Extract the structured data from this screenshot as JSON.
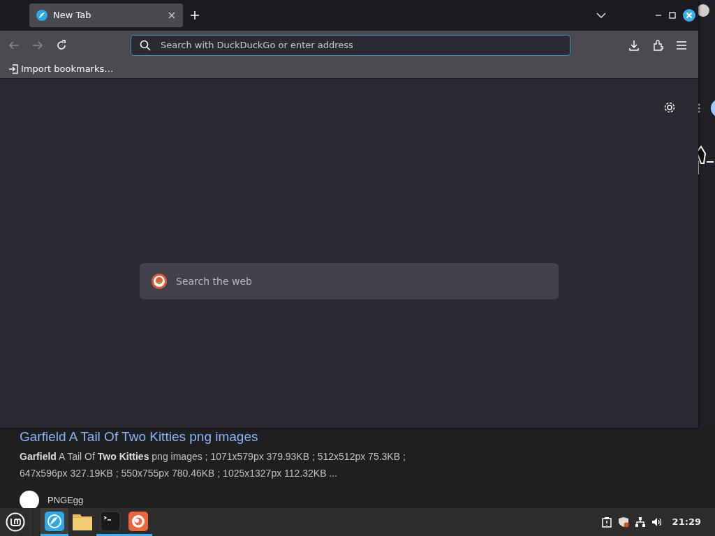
{
  "browser": {
    "tabs": [
      {
        "title": "New Tab",
        "selected": true
      }
    ],
    "address_bar": {
      "placeholder": "Search with DuckDuckGo or enter address"
    },
    "bookmarks": [
      {
        "label": "Import bookmarks…"
      }
    ],
    "new_tab_page": {
      "search": {
        "placeholder": "Search the web"
      }
    }
  },
  "background_page": {
    "result": {
      "title": "Garfield A Tail Of Two Kitties png images",
      "snippet": "**Garfield** A Tail Of **Two Kitties** png images ; 1071x579px 379.93KB ; 512x512px 75.3KB ; 647x596px 327.19KB ; 550x755px 780.46KB ; 1025x1327px 112.32KB ..."
    },
    "next_result": {
      "site": "PNGEgg"
    }
  },
  "taskbar": {
    "apps": [
      {
        "kind": "browser",
        "selected": true,
        "running": true
      },
      {
        "kind": "files",
        "selected": false,
        "running": false
      },
      {
        "kind": "terminal",
        "selected": false,
        "running": true
      },
      {
        "kind": "firefox",
        "selected": false,
        "running": true
      }
    ],
    "clock": "21:29"
  }
}
